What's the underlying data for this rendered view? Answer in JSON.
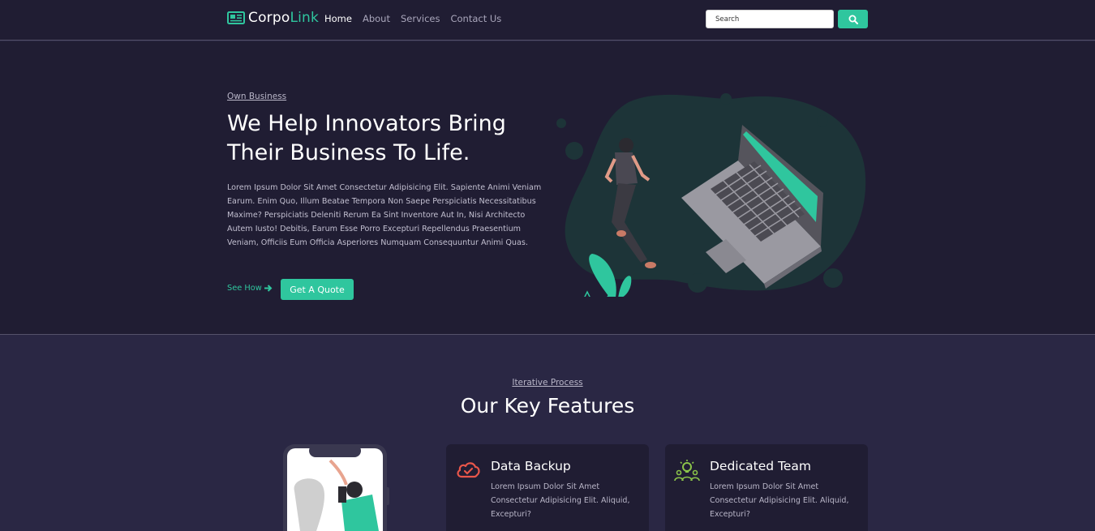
{
  "nav": {
    "brand_prefix": "Corpo",
    "brand_suffix": "Link",
    "links": [
      "Home",
      "About",
      "Services",
      "Contact Us"
    ],
    "search_placeholder": "Search"
  },
  "hero": {
    "eyebrow": "Own Business",
    "title": "We Help Innovators Bring Their Business To Life.",
    "text": "Lorem Ipsum Dolor Sit Amet Consectetur Adipisicing Elit. Sapiente Animi Veniam Earum. Enim Quo, Illum Beatae Tempora Non Saepe Perspiciatis Necessitatibus Maxime? Perspiciatis Deleniti Rerum Ea Sint Inventore Aut In, Nisi Architecto Autem Iusto! Debitis, Earum Esse Porro Excepturi Repellendus Praesentium Veniam, Officiis Eum Officia Asperiores Numquam Consequuntur Animi Quas.",
    "see_how": "See How",
    "quote_button": "Get A Quote"
  },
  "features": {
    "eyebrow": "Iterative Process",
    "title": "Our Key Features",
    "cards": [
      {
        "title": "Data Backup",
        "text": "Lorem Ipsum Dolor Sit Amet Consectetur Adipisicing Elit. Aliquid, Excepturi?",
        "icon": "cloud-check-icon"
      },
      {
        "title": "Dedicated Team",
        "text": "Lorem Ipsum Dolor Sit Amet Consectetur Adipisicing Elit. Aliquid, Excepturi?",
        "icon": "team-idea-icon"
      }
    ]
  },
  "colors": {
    "accent": "#2fc69e",
    "background": "#201d33",
    "section_background": "#2a2744",
    "backup_icon": "#e9564a",
    "team_icon": "#8bc34a"
  }
}
